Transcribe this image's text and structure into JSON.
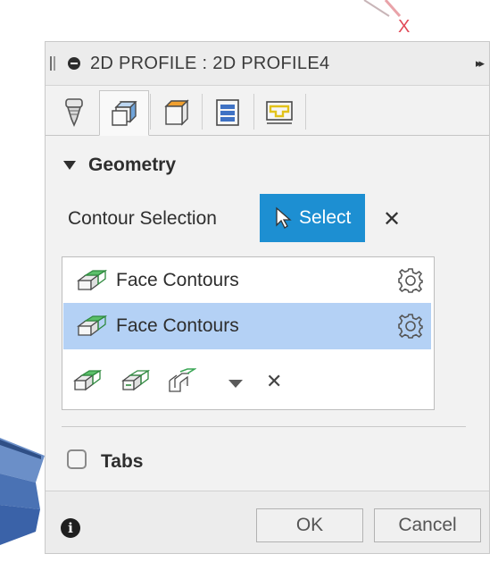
{
  "dialog": {
    "title": "2D PROFILE : 2D PROFILE4",
    "expand_glyph": "▸▸",
    "tabs": [
      {
        "icon": "tool-icon",
        "active": false
      },
      {
        "icon": "geometry-icon",
        "active": true
      },
      {
        "icon": "heights-icon",
        "active": false
      },
      {
        "icon": "passes-icon",
        "active": false
      },
      {
        "icon": "linking-icon",
        "active": false
      }
    ]
  },
  "geometry": {
    "section_title": "Geometry",
    "contour_label": "Contour Selection",
    "select_label": "Select",
    "clear_glyph": "✕",
    "contours": [
      {
        "label": "Face Contours",
        "selected": false
      },
      {
        "label": "Face Contours",
        "selected": true
      }
    ],
    "list_clear_glyph": "✕"
  },
  "tabs_section": {
    "label": "Tabs",
    "checked": false
  },
  "footer": {
    "info_glyph": "i",
    "ok_label": "OK",
    "cancel_label": "Cancel"
  },
  "colors": {
    "select_button": "#1d8fd2",
    "selected_row": "#b4d1f5",
    "contour_icon_green": "#3aa655"
  },
  "background": {
    "axis_label": "X"
  }
}
